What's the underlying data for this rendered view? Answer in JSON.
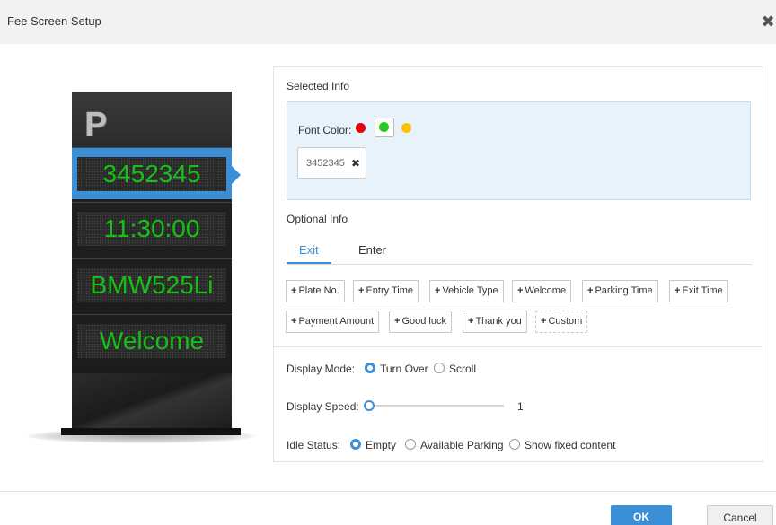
{
  "dialog": {
    "title": "Fee Screen Setup",
    "close_icon": "close-icon"
  },
  "preview": {
    "logo": "P",
    "led_lines": [
      "3452345",
      "11:30:00",
      "BMW525Li",
      "Welcome"
    ],
    "selected_index": 0,
    "led_color": "#16c016",
    "accent": "#3b8fd6"
  },
  "selected_info": {
    "label": "Selected Info",
    "font_color_label": "Font Color:",
    "colors": [
      "#e60012",
      "#22cc22",
      "#ffc000"
    ],
    "selected_color": "#22cc22",
    "tag": "3452345",
    "tag_remove_icon": "close-icon"
  },
  "optional_info": {
    "label": "Optional Info",
    "tabs": [
      "Exit",
      "Enter"
    ],
    "active_tab": "Exit",
    "plus": "+",
    "chips_row1": [
      "Plate No.",
      "Entry Time",
      "Vehicle Type",
      "Welcome",
      "Parking Time",
      "Exit Time"
    ],
    "chips_row2": [
      "Payment Amount",
      "Good luck",
      "Thank you"
    ],
    "custom_chip": "Custom"
  },
  "display_mode": {
    "label": "Display Mode:",
    "options": [
      "Turn Over",
      "Scroll"
    ],
    "selected": "Turn Over"
  },
  "display_speed": {
    "label": "Display Speed:",
    "value": "1"
  },
  "idle_status": {
    "label": "Idle Status:",
    "options": [
      "Empty",
      "Available Parking",
      "Show fixed content"
    ],
    "selected": "Empty"
  },
  "footer": {
    "ok_label": "OK",
    "cancel_label": "Cancel"
  }
}
